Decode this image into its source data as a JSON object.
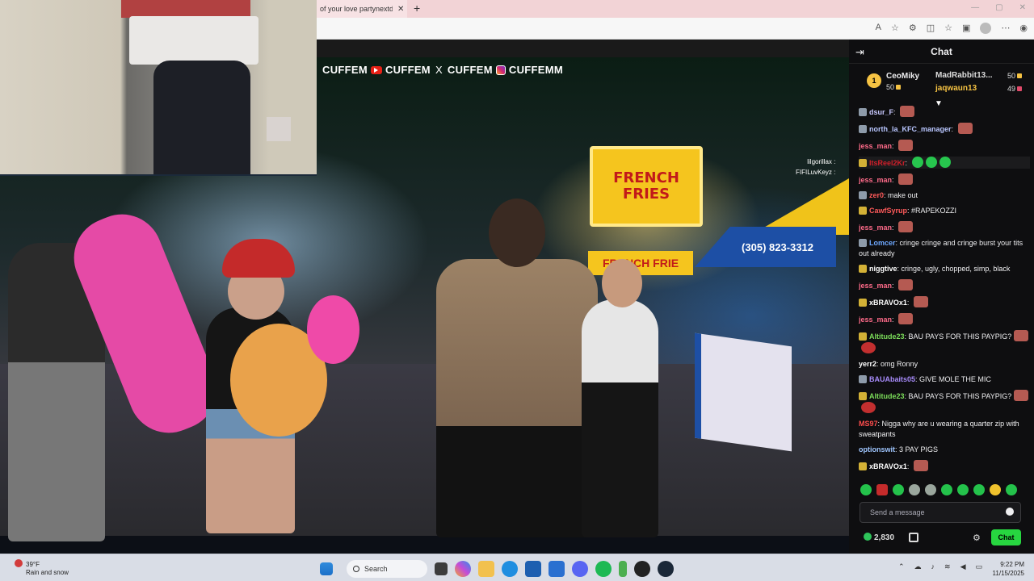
{
  "browser": {
    "tab_title": "of your love partynextdoor",
    "tab_close": "✕",
    "new_tab": "+"
  },
  "stream": {
    "overlay_parts": [
      "CUFFEM",
      "CUFFEM",
      "X",
      "CUFFEM",
      "CUFFEMM"
    ],
    "mini_chat": [
      "lilgorillax :",
      "FIFILuvKeyz :"
    ]
  },
  "fries_sign": {
    "top": "FRENCH",
    "bottom": "FRIES",
    "lower": "FRENCH FRIE"
  },
  "tent_phone": "(305) 823-3312",
  "chat": {
    "title": "Chat",
    "leaderboard": [
      {
        "rank": "1",
        "name": "CeoMiky",
        "points": "50",
        "color": "#f6c343"
      },
      {
        "name": "MadRabbit13...",
        "points": "50",
        "color": "#cfcfd4"
      },
      {
        "name": "jaqwaun13",
        "points": "49",
        "color": "#f0a060"
      }
    ],
    "messages": [
      {
        "user": "dsur_F",
        "color": "#c9c9ff",
        "text": "",
        "badge": "sub",
        "emote": "face"
      },
      {
        "user": "north_la_KFC_manager",
        "color": "#b9c6ff",
        "text": "",
        "badge": "sub",
        "emote": "face"
      },
      {
        "user": "jess_man",
        "color": "#ff6b8a",
        "text": "",
        "badge": "",
        "emote": "face"
      },
      {
        "user": "ItsReel2Kr",
        "color": "#d11f2a",
        "text": "",
        "badge": "gold",
        "emote": "green3",
        "hl": true
      },
      {
        "user": "jess_man",
        "color": "#ff6b8a",
        "text": "",
        "badge": "",
        "emote": "face"
      },
      {
        "user": "zer0",
        "color": "#ff5a5a",
        "text": "make out",
        "badge": "sub",
        "emote": ""
      },
      {
        "user": "CawfSyrup",
        "color": "#ff5a5a",
        "text": "#RAPEKOZZI",
        "badge": "gold",
        "emote": ""
      },
      {
        "user": "jess_man",
        "color": "#ff6b8a",
        "text": "",
        "badge": "",
        "emote": "face"
      },
      {
        "user": "Lomcer",
        "color": "#6ea8ff",
        "text": "cringe cringe and cringe burst your tits out already",
        "badge": "sub",
        "emote": ""
      },
      {
        "user": "niggtive",
        "color": "#ffffff",
        "text": "cringe, ugly, chopped, simp, black",
        "badge": "gold",
        "emote": ""
      },
      {
        "user": "jess_man",
        "color": "#ff6b8a",
        "text": "",
        "badge": "",
        "emote": "face"
      },
      {
        "user": "xBRAVOx1",
        "color": "#ffffff",
        "text": "",
        "badge": "gold",
        "emote": "face"
      },
      {
        "user": "jess_man",
        "color": "#ff6b8a",
        "text": "",
        "badge": "",
        "emote": "face"
      },
      {
        "user": "Altitude23",
        "color": "#7bdc5a",
        "text": "BAU PAYS FOR THIS PAYPIG?",
        "badge": "gold",
        "emote": "face2"
      },
      {
        "user": "yerr2",
        "color": "#ffffff",
        "text": "omg Ronny",
        "badge": "",
        "emote": ""
      },
      {
        "user": "BAUAbaits05",
        "color": "#a78bfa",
        "text": "GIVE MOLE THE MIC",
        "badge": "sub",
        "emote": ""
      },
      {
        "user": "Altitude23",
        "color": "#7bdc5a",
        "text": "BAU PAYS FOR THIS PAYPIG?",
        "badge": "gold",
        "emote": "face2"
      },
      {
        "user": "MS97",
        "color": "#ff4d4d",
        "text": "Nigga why are u wearing a quarter zip with sweatpants",
        "badge": "",
        "emote": ""
      },
      {
        "user": "optionswit",
        "color": "#9fc6ff",
        "text": "3 PAY PIGS",
        "badge": "",
        "emote": ""
      },
      {
        "user": "xBRAVOx1",
        "color": "#ffffff",
        "text": "",
        "badge": "gold",
        "emote": "face"
      }
    ],
    "input_placeholder": "Send a message",
    "points": "2,830",
    "chat_button": "Chat"
  },
  "taskbar": {
    "temp": "39°F",
    "weather": "Rain and snow",
    "search": "Search",
    "time": "9:22 PM",
    "date": "11/15/2025"
  }
}
